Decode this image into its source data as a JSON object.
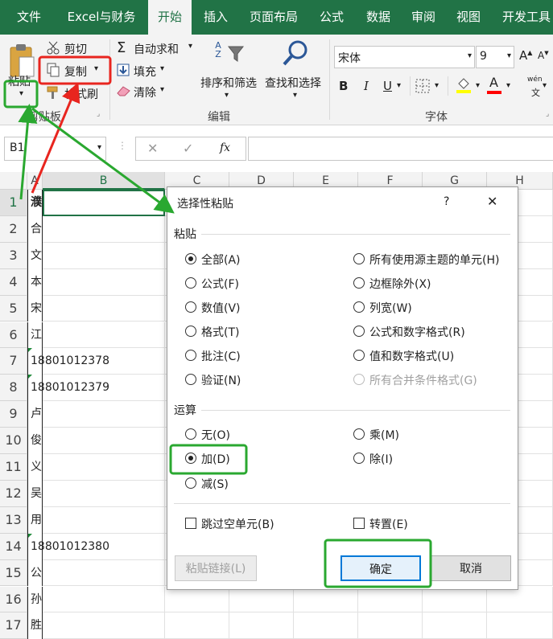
{
  "tabs": [
    "文件",
    "Excel与财务",
    "开始",
    "插入",
    "页面布局",
    "公式",
    "数据",
    "审阅",
    "视图",
    "开发工具"
  ],
  "ribbon": {
    "paste_label": "粘贴",
    "cut_label": "剪切",
    "copy_label": "复制",
    "format_painter_label": "格式刷",
    "clipboard_group": "剪贴板",
    "autosum_label": "自动求和",
    "fill_label": "填充",
    "clear_label": "清除",
    "sort_filter_label": "排序和筛选",
    "find_select_label": "查找和选择",
    "editing_group": "编辑",
    "font_name": "宋体",
    "font_size": "9",
    "font_group": "字体",
    "bold": "B",
    "italic": "I",
    "underline": "U",
    "font_grow": "A",
    "font_shrink": "A",
    "font_color_letter": "A",
    "phonetic": "wén",
    "sort_icon_letters": "A Z"
  },
  "formula_bar": {
    "name_box": "B1",
    "fx": "fx"
  },
  "columns": [
    "A",
    "B",
    "C",
    "D",
    "E",
    "F",
    "G",
    "H"
  ],
  "rows": [
    "1",
    "2",
    "3",
    "4",
    "5",
    "6",
    "7",
    "8",
    "9",
    "10",
    "11",
    "12",
    "13",
    "14",
    "15",
    "16",
    "17"
  ],
  "col_a_values": [
    "濮",
    "合",
    "文",
    "本",
    "宋",
    "江",
    "18801012378",
    "18801012379",
    "卢",
    "俊",
    "义",
    "吴",
    "用",
    "18801012380",
    "公",
    "孙",
    "胜"
  ],
  "dialog": {
    "title": "选择性粘贴",
    "help": "?",
    "close": "✕",
    "paste_section": "粘贴",
    "paste_options_left": [
      "全部(A)",
      "公式(F)",
      "数值(V)",
      "格式(T)",
      "批注(C)",
      "验证(N)"
    ],
    "paste_options_right": [
      "所有使用源主题的单元(H)",
      "边框除外(X)",
      "列宽(W)",
      "公式和数字格式(R)",
      "值和数字格式(U)",
      "所有合并条件格式(G)"
    ],
    "operation_section": "运算",
    "operation_left": [
      "无(O)",
      "加(D)",
      "减(S)"
    ],
    "operation_right": [
      "乘(M)",
      "除(I)"
    ],
    "skip_blanks": "跳过空单元(B)",
    "transpose": "转置(E)",
    "paste_link": "粘贴链接(L)",
    "ok": "确定",
    "cancel": "取消"
  },
  "colors": {
    "ribbon_green": "#217346",
    "annotation_red": "#e8251f",
    "annotation_green": "#2aa830",
    "fill_yellow": "#ffff00",
    "font_red": "#ff0000"
  }
}
